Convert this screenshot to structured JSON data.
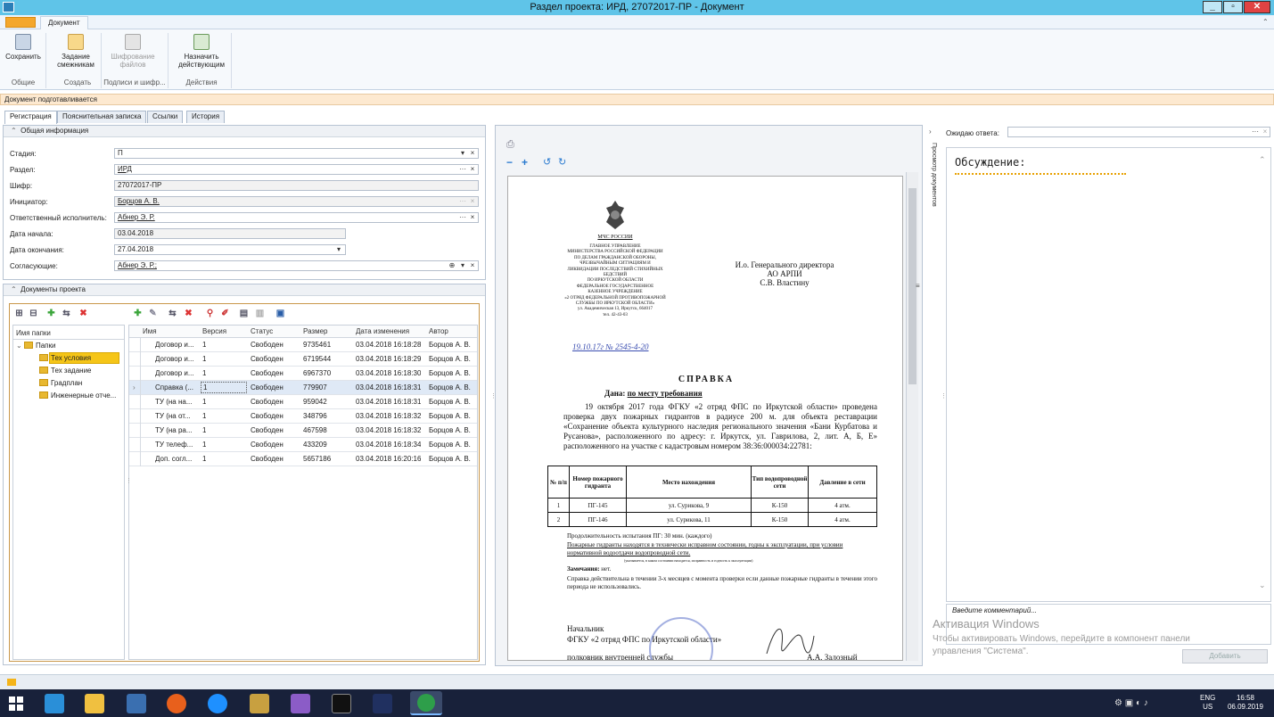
{
  "window": {
    "title": "Раздел проекта: ИРД, 27072017-ПР - Документ",
    "minimize": "_",
    "maximize": "▫",
    "close": "✕"
  },
  "ribbon": {
    "tab": "Документ",
    "buttons": {
      "save": "Сохранить",
      "task": "Задание смежникам",
      "encrypt": "Шифрование файлов",
      "assign": "Назначить действующим"
    },
    "groups": {
      "general": "Общие",
      "create": "Создать",
      "sign": "Подписи и шифр...",
      "actions": "Действия"
    }
  },
  "status": "Документ подготавливается",
  "tabs": [
    "Регистрация",
    "Пояснительная записка",
    "Ссылки",
    "История"
  ],
  "general": {
    "header": "Общая информация",
    "fields": [
      {
        "label": "Стадия:",
        "value": "П"
      },
      {
        "label": "Раздел:",
        "value": "ИРД"
      },
      {
        "label": "Шифр:",
        "value": "27072017-ПР"
      },
      {
        "label": "Инициатор:",
        "value": "Борцов А. В."
      },
      {
        "label": "Ответственный исполнитель:",
        "value": "Абнер Э. Р."
      },
      {
        "label": "Дата начала:",
        "value": "03.04.2018"
      },
      {
        "label": "Дата окончания:",
        "value": "27.04.2018"
      },
      {
        "label": "Согласующие:",
        "value": "Абнер Э. Р.;"
      }
    ]
  },
  "docs": {
    "header": "Документы проекта",
    "tree_header": "Имя папки",
    "root": "Папки",
    "folders": [
      "Тех условия",
      "Тех задание",
      "Градплан",
      "Инженерные отче..."
    ],
    "columns": [
      "Имя",
      "Версия",
      "Статус",
      "Размер",
      "Дата изменения",
      "Автор"
    ],
    "rows": [
      [
        "Договор и...",
        "1",
        "Свободен",
        "9735461",
        "03.04.2018 16:18:28",
        "Борцов А. В."
      ],
      [
        "Договор и...",
        "1",
        "Свободен",
        "6719544",
        "03.04.2018 16:18:29",
        "Борцов А. В."
      ],
      [
        "Договор и...",
        "1",
        "Свободен",
        "6967370",
        "03.04.2018 16:18:30",
        "Борцов А. В."
      ],
      [
        "Справка (...",
        "1",
        "Свободен",
        "779907",
        "03.04.2018 16:18:31",
        "Борцов А. В."
      ],
      [
        "ТУ (на на...",
        "1",
        "Свободен",
        "959042",
        "03.04.2018 16:18:31",
        "Борцов А. В."
      ],
      [
        "ТУ (на от...",
        "1",
        "Свободен",
        "348796",
        "03.04.2018 16:18:32",
        "Борцов А. В."
      ],
      [
        "ТУ (на ра...",
        "1",
        "Свободен",
        "467598",
        "03.04.2018 16:18:32",
        "Борцов А. В."
      ],
      [
        "ТУ телеф...",
        "1",
        "Свободен",
        "433209",
        "03.04.2018 16:18:34",
        "Борцов А. В."
      ],
      [
        "Доп. согл...",
        "1",
        "Свободен",
        "5657186",
        "03.04.2018 16:20:16",
        "Борцов А. В."
      ]
    ]
  },
  "preview": {
    "side_label": "Просмотр документов",
    "letter": {
      "org_short": "МЧС РОССИИ",
      "org": [
        "ГЛАВНОЕ УПРАВЛЕНИЕ",
        "МИНИСТЕРСТВА РОССИЙСКОЙ ФЕДЕРАЦИИ",
        "ПО ДЕЛАМ ГРАЖДАНСКОЙ ОБОРОНЫ,",
        "ЧРЕЗВЫЧАЙНЫМ СИТУАЦИЯМ И",
        "ЛИКВИДАЦИИ ПОСЛЕДСТВИЙ СТИХИЙНЫХ",
        "БЕДСТВИЙ",
        "ПО ИРКУТСКОЙ ОБЛАСТИ",
        "ФЕДЕРАЛЬНОЕ ГОСУДАРСТВЕННОЕ",
        "КАЗЕННОЕ УЧРЕЖДЕНИЕ",
        "«2 ОТРЯД ФЕДЕРАЛЬНОЙ ПРОТИВОПОЖАРНОЙ",
        "СЛУЖБЫ ПО ИРКУТСКОЙ ОБЛАСТИ»",
        "ул. Академическая 13, Иркутск, 664017",
        "тел. 42-43-03"
      ],
      "addressee": [
        "И.о. Генерального директора",
        "АО АРПИ",
        "С.В. Властину"
      ],
      "reg": "19.10.17г  № 2545-4-20",
      "title": "СПРАВКА",
      "given_label": "Дана:",
      "given": "по месту требования",
      "body": "19 октября 2017 года ФГКУ «2 отряд ФПС по Иркутской области» проведена проверка двух пожарных гидрантов в радиусе 200 м. для объекта реставрации «Сохранение объекта культурного наследия регионального значения «Бани Курбатова и Русанова», расположенного по адресу: г. Иркутск, ул. Гаврилова, 2, лит. А, Б, Е» расположенного на участке с кадастровым номером 38:36:000034:22781:",
      "table_head": [
        "№ п/п",
        "Номер пожарного гидранта",
        "Место нахождения",
        "Тип водопроводной сети",
        "Давление в сети"
      ],
      "table_rows": [
        [
          "1",
          "ПГ-145",
          "ул. Сурикова, 9",
          "К-150",
          "4 атм."
        ],
        [
          "2",
          "ПГ-146",
          "ул. Сурикова, 11",
          "К-150",
          "4 атм."
        ]
      ],
      "duration": "Продолжительность испытания  ПГ: 30 мин. (каждого)",
      "condition": "Пожарные гидранты находятся в технически исправном состоянии, годны к эксплуатации, при условии нормативной водоотдачи водопроводной сети.",
      "note_small": "(указывается, в каком состоянии находится, исправность и годность к эксплуатации)",
      "remarks_label": "Замечания:",
      "remarks": "нет.",
      "validity": "Справка действительна в течении 3-х месяцев с момента проверки если данные пожарные гидранты в течении этого периода не использовались.",
      "sign1": "Начальник",
      "sign2": "ФГКУ «2 отряд ФПС по Иркутской области»",
      "sign3": "полковник внутренней службы",
      "signer": "А.А. Залозный"
    }
  },
  "discussion": {
    "waiting_label": "Ожидаю ответа:",
    "title": "Обсуждение:",
    "placeholder": "Введите комментарий...",
    "add_button": "Добавить"
  },
  "watermark": {
    "line1": "Активация Windows",
    "line2": "Чтобы активировать Windows, перейдите в компонент панели",
    "line3": "управления \"Система\"."
  },
  "tray": {
    "lang1": "ENG",
    "lang2": "US",
    "time": "16:58",
    "date": "06.09.2019"
  }
}
